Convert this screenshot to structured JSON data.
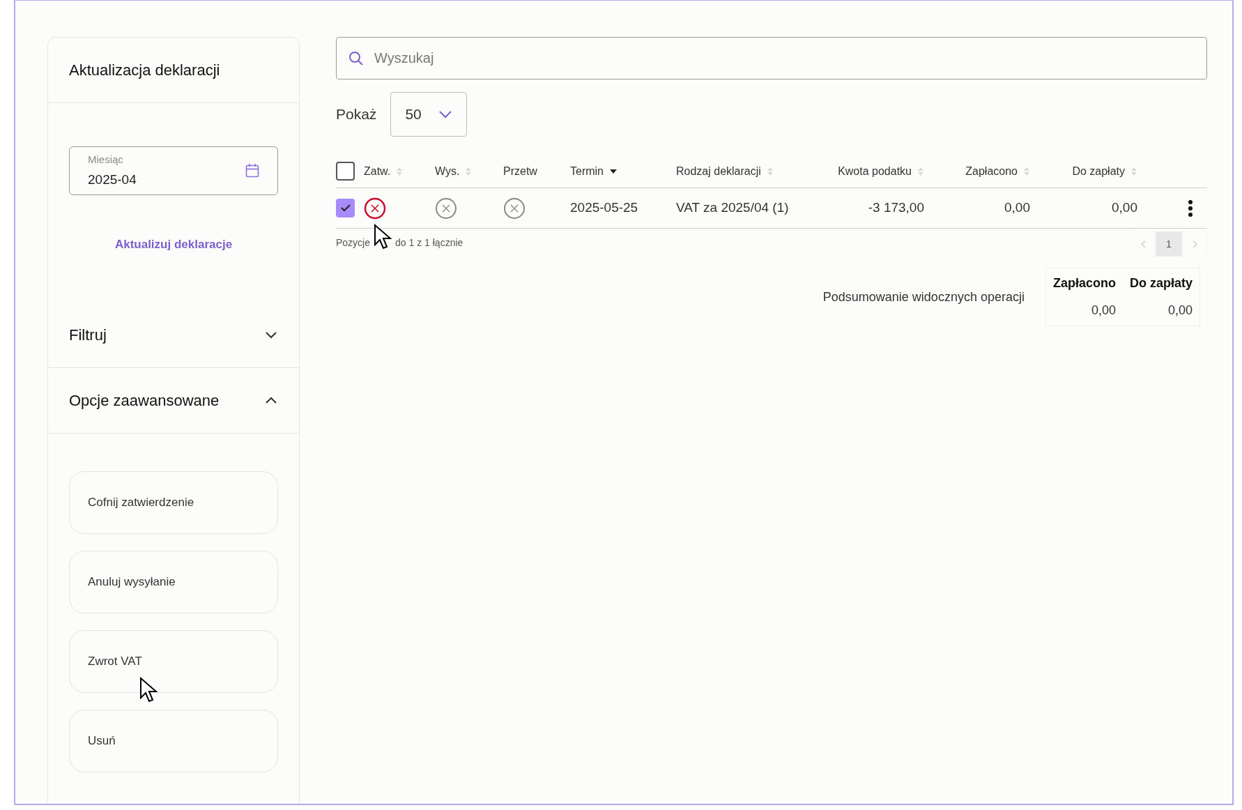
{
  "sidebar": {
    "title": "Aktualizacja deklaracji",
    "month_field": {
      "label": "Miesiąc",
      "value": "2025-04"
    },
    "update_link": "Aktualizuj deklaracje",
    "sections": [
      {
        "label": "Filtruj",
        "expanded": false
      },
      {
        "label": "Opcje zaawansowane",
        "expanded": true
      }
    ],
    "actions": [
      "Cofnij zatwierdzenie",
      "Anuluj wysyłanie",
      "Zwrot VAT",
      "Usuń"
    ]
  },
  "search": {
    "placeholder": "Wyszukaj"
  },
  "page_size": {
    "label": "Pokaż",
    "value": "50"
  },
  "table": {
    "all_checked": false,
    "columns": [
      {
        "label": "Zatw.",
        "sortable": true,
        "sorted": false
      },
      {
        "label": "Wys.",
        "sortable": true,
        "sorted": false
      },
      {
        "label": "Przetw",
        "sortable": false,
        "sorted": false
      },
      {
        "label": "Termin",
        "sortable": true,
        "sorted": true
      },
      {
        "label": "Rodzaj deklaracji",
        "sortable": true,
        "sorted": false
      },
      {
        "label": "Kwota podatku",
        "sortable": true,
        "sorted": false
      },
      {
        "label": "Zapłacono",
        "sortable": true,
        "sorted": false
      },
      {
        "label": "Do zapłaty",
        "sortable": true,
        "sorted": false
      }
    ],
    "rows": [
      {
        "selected": true,
        "approved_failed": true,
        "sent_failed": false,
        "processed_failed": false,
        "date": "2025-05-25",
        "type": "VAT za 2025/04 (1)",
        "tax": "-3 173,00",
        "paid": "0,00",
        "due": "0,00"
      }
    ]
  },
  "pagination": {
    "info_start": "Pozycje",
    "info_end": "do 1 z 1 łącznie",
    "pages": [
      {
        "label": "1",
        "selected": true
      }
    ],
    "prev_disabled": true,
    "next_disabled": true
  },
  "summary": {
    "label": "Podsumowanie widocznych operacji",
    "columns": [
      "Zapłacono",
      "Do zapłaty"
    ],
    "values": [
      "0,00",
      "0,00"
    ]
  }
}
